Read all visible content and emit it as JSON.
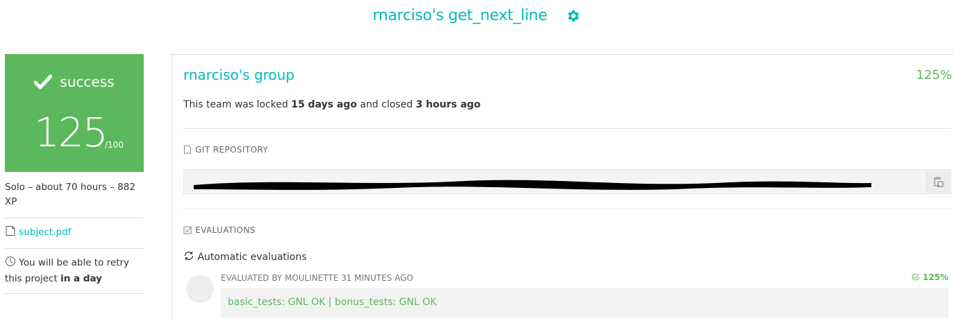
{
  "header": {
    "title": "rnarciso's get_next_line",
    "settings_icon": "gear-icon",
    "accent": "#00babc"
  },
  "result": {
    "status": "success",
    "status_icon": "checkmark-icon",
    "score": "125",
    "max_score": "/100",
    "color": "#5cb85c"
  },
  "sidebar": {
    "meta": "Solo – about 70 hours – 882 XP",
    "subject_link": "subject.pdf",
    "subject_icon": "document-icon",
    "retry_prefix": "You will be able to retry this project",
    "retry_time": "in a day",
    "retry_icon": "clock-icon"
  },
  "team": {
    "name": "rnarciso's group",
    "percentage": "125%",
    "lock_prefix": "This team was locked",
    "locked_ago": "15 days ago",
    "lock_middle": "and closed",
    "closed_ago": "3 hours ago"
  },
  "repository": {
    "label": "GIT REPOSITORY",
    "label_icon": "file-icon",
    "copy_icon": "clipboard-icon"
  },
  "evaluations": {
    "label": "EVALUATIONS",
    "label_icon": "checkbox-icon",
    "auto_label": "Automatic evaluations",
    "auto_icon": "refresh-icon",
    "evaluated_by": "EVALUATED BY MOULINETTE 31 MINUTES AGO",
    "score": "125%",
    "score_icon": "check-circle-icon",
    "result_text": "basic_tests: GNL OK | bonus_tests: GNL OK"
  }
}
